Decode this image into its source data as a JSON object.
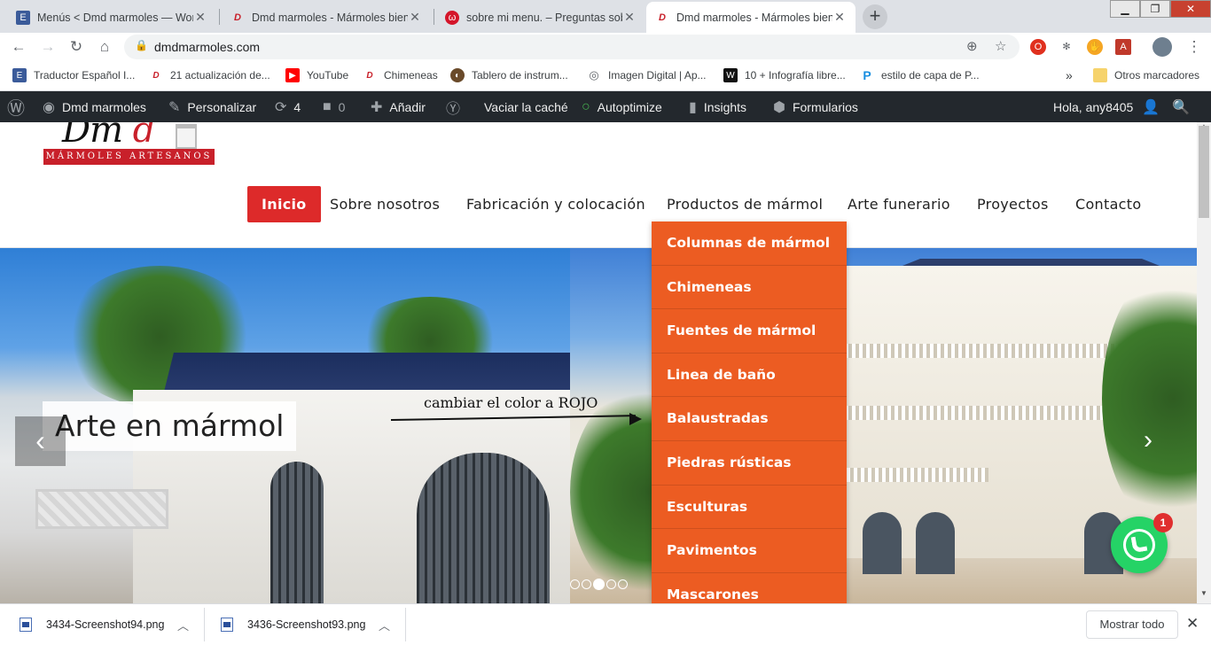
{
  "browser": {
    "tabs": [
      {
        "title": "Menús < Dmd marmoles — Wor",
        "icon": "wordpress-admin-icon",
        "active": false
      },
      {
        "title": "Dmd marmoles - Mármoles bien",
        "icon": "dmd-favicon",
        "active": false
      },
      {
        "title": "sobre mi menu. – Preguntas sobr",
        "icon": "question-site-icon",
        "active": false
      },
      {
        "title": "Dmd marmoles - Mármoles bien",
        "icon": "dmd-favicon",
        "active": true
      }
    ],
    "new_tab": "+",
    "url": "dmdmarmoles.com",
    "bookmarks": [
      {
        "label": "Traductor Español I...",
        "icon": "translate-icon",
        "color": "#3b5b9a"
      },
      {
        "label": "21 actualización de...",
        "icon": "dmd-favicon",
        "color": "#c8202a"
      },
      {
        "label": "YouTube",
        "icon": "youtube-icon",
        "color": "#ff0000"
      },
      {
        "label": "Chimeneas",
        "icon": "dmd-favicon",
        "color": "#c8202a"
      },
      {
        "label": "Tablero de instrum...",
        "icon": "dashboard-icon",
        "color": "#6a4a2a"
      },
      {
        "label": "Imagen Digital | Ap...",
        "icon": "globe-icon",
        "color": "#5f6368"
      },
      {
        "label": "10 + Infografía libre...",
        "icon": "w-icon",
        "color": "#111111"
      },
      {
        "label": "estilo de capa de P...",
        "icon": "p-icon",
        "color": "#1a8fe0"
      }
    ],
    "more": "»",
    "other_bookmarks": "Otros marcadores"
  },
  "admin_bar": {
    "site_name": "Dmd marmoles",
    "customize": "Personalizar",
    "updates": "4",
    "comments": "0",
    "add_new": "Añadir",
    "clear_cache": "Vaciar la caché",
    "autoptimize": "Autoptimize",
    "insights": "Insights",
    "forms": "Formularios",
    "greeting": "Hola, any8405"
  },
  "site": {
    "logo_script": "Dmd",
    "logo_band": "MÁRMOLES ARTESANOS",
    "menu": [
      {
        "label": "Inicio",
        "active": true
      },
      {
        "label": "Sobre nosotros",
        "active": false
      },
      {
        "label": "Fabricación y colocación",
        "active": false
      },
      {
        "label": "Productos de mármol",
        "active": false
      },
      {
        "label": "Arte funerario",
        "active": false
      },
      {
        "label": "Proyectos",
        "active": false
      },
      {
        "label": "Contacto",
        "active": false
      }
    ],
    "submenu": [
      "Columnas de mármol",
      "Chimeneas",
      "Fuentes de mármol",
      "Linea de baño",
      "Balaustradas",
      "Piedras rústicas",
      "Esculturas",
      "Pavimentos",
      "Mascarones"
    ],
    "submenu_color": "#ec5c22",
    "active_color": "#dd2a2a",
    "annotation": "cambiar el color a ROJO",
    "slider_caption": "Arte en mármol",
    "slider_prev": "‹",
    "slider_next": "›",
    "slider_slides": 5,
    "slider_current": 3,
    "whatsapp_badge": "1"
  },
  "downloads": {
    "items": [
      "3434-Screenshot94.png",
      "3436-Screenshot93.png"
    ],
    "show_all": "Mostrar todo"
  }
}
